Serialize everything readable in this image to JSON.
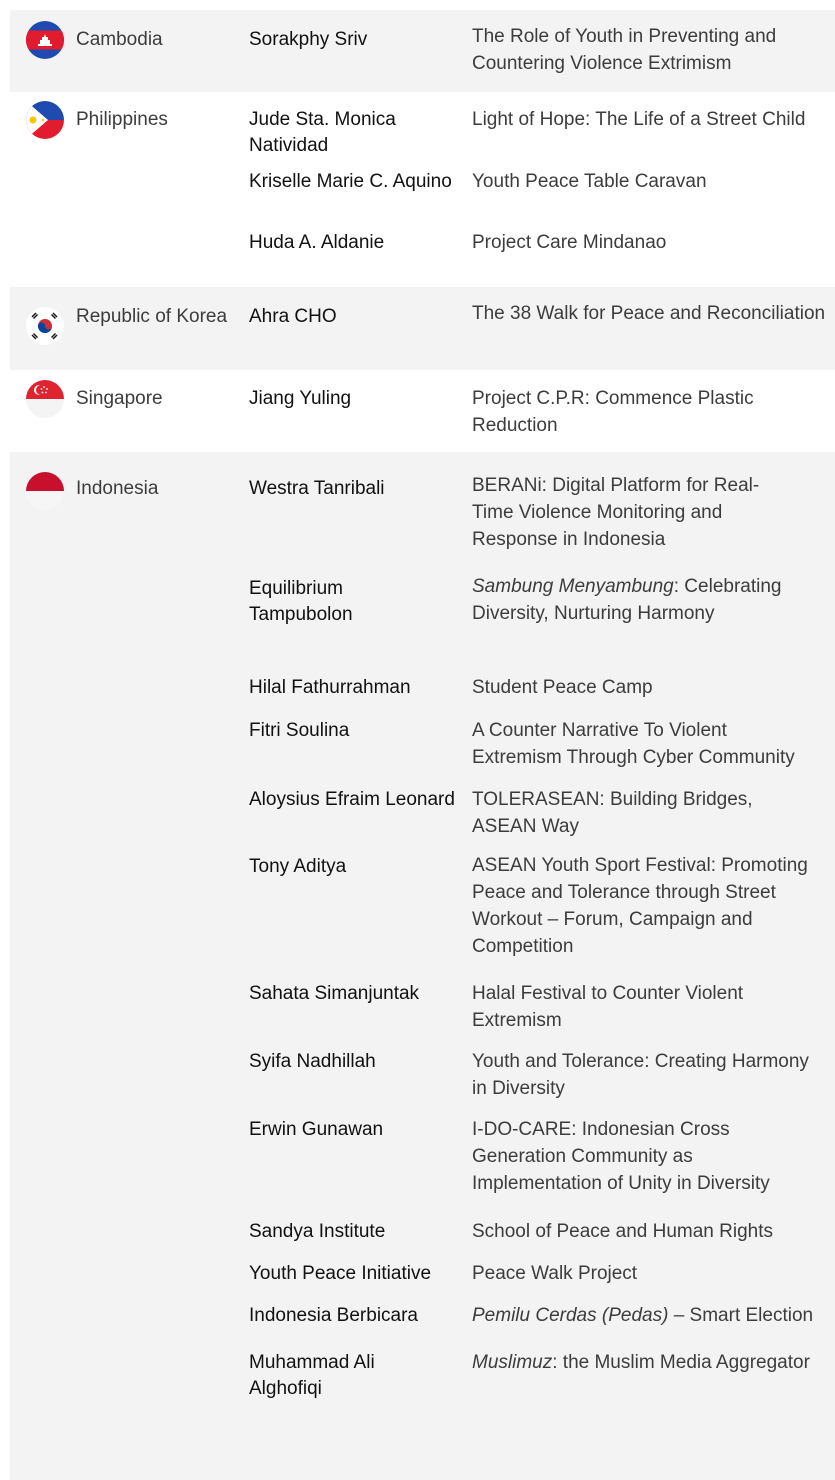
{
  "rows": [
    {
      "country": "Cambodia",
      "flag_icon": "cambodia-flag-icon",
      "entries": [
        {
          "name": "Sorakphy Sriv",
          "project": "The Role of Youth in Preventing and Countering Violence Extrimism"
        }
      ]
    },
    {
      "country": "Philippines",
      "flag_icon": "philippines-flag-icon",
      "entries": [
        {
          "name": "Jude Sta. Monica Natividad",
          "project": "Light of Hope: The Life of a Street Child"
        },
        {
          "name": "Kriselle Marie C. Aquino",
          "project": "Youth Peace Table Caravan"
        },
        {
          "name": "Huda A. Aldanie",
          "project": "Project Care Mindanao"
        }
      ]
    },
    {
      "country": "Republic of Korea",
      "flag_icon": "south-korea-flag-icon",
      "entries": [
        {
          "name": "Ahra CHO",
          "project": "The 38 Walk for Peace and Reconciliation"
        }
      ]
    },
    {
      "country": "Singapore",
      "flag_icon": "singapore-flag-icon",
      "entries": [
        {
          "name": "Jiang Yuling",
          "project": "Project C.P.R: Commence Plastic Reduction"
        }
      ]
    },
    {
      "country": "Indonesia",
      "flag_icon": "indonesia-flag-icon",
      "entries": [
        {
          "name": "Westra Tanribali",
          "project": "BERANi: Digital Platform for Real-Time Violence Monitoring and Response in Indonesia"
        },
        {
          "name": "Equilibrium Tampubolon",
          "project_italic": "Sambung Menyambung",
          "project": ": Celebrating Diversity, Nurturing Harmony"
        },
        {
          "name": "Hilal Fathurrahman",
          "project": "Student Peace Camp"
        },
        {
          "name": "Fitri Soulina",
          "project": "A Counter Narrative To Violent Extremism Through Cyber Community"
        },
        {
          "name": "Aloysius Efraim Leonard",
          "project": "TOLERASEAN: Building Bridges, ASEAN Way"
        },
        {
          "name": "Tony Aditya",
          "project": "ASEAN Youth Sport Festival: Promoting Peace and Tolerance through Street Workout – Forum, Campaign and Competition"
        },
        {
          "name": "Sahata Simanjuntak",
          "project": "Halal Festival to Counter Violent Extremism"
        },
        {
          "name": "Syifa Nadhillah",
          "project": "Youth and Tolerance: Creating Harmony in Diversity"
        },
        {
          "name": "Erwin Gunawan",
          "project": "I-DO-CARE: Indonesian Cross Generation Community as Implementation of Unity in Diversity"
        },
        {
          "name": "Sandya Institute",
          "project": "School of Peace and Human Rights"
        },
        {
          "name": "Youth Peace Initiative",
          "project": "Peace Walk Project"
        },
        {
          "name": "Indonesia Berbicara",
          "project_italic": "Pemilu Cerdas (Pedas)",
          "project": " – Smart Election"
        },
        {
          "name": "Muhammad Ali Alghofiqi",
          "project_italic": "Muslimuz",
          "project": ": the Muslim Media Aggregator"
        }
      ]
    }
  ]
}
